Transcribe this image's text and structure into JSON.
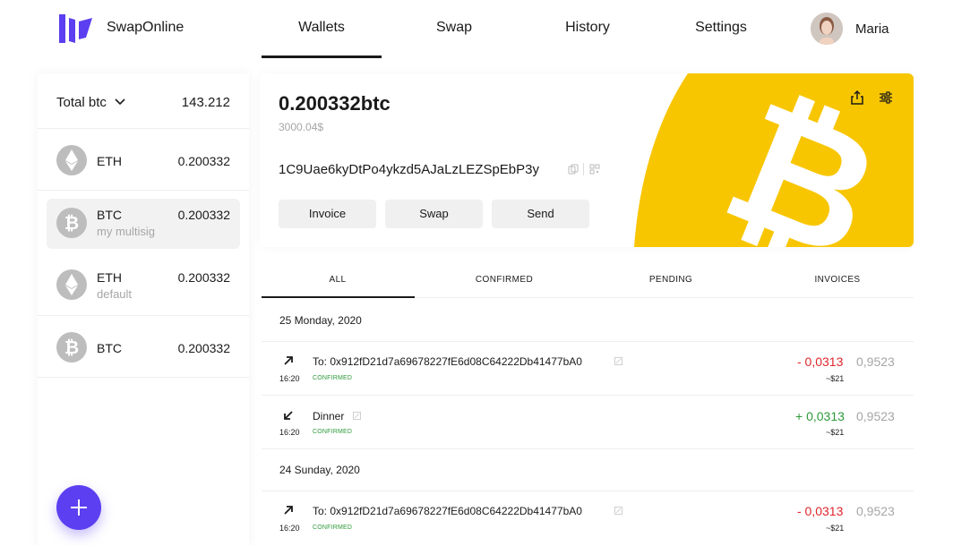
{
  "header": {
    "brand": "SwapOnline",
    "nav": [
      "Wallets",
      "Swap",
      "History",
      "Settings"
    ],
    "active_nav": "Wallets",
    "user_name": "Maria",
    "brand_color": "#5b3ff0"
  },
  "sidebar": {
    "total_label": "Total btc",
    "total_value": "143.212",
    "wallets": [
      {
        "coin": "ETH",
        "subtitle": "",
        "amount": "0.200332",
        "icon": "eth-icon"
      },
      {
        "coin": "BTC",
        "subtitle": "my multisig",
        "amount": "0.200332",
        "icon": "btc-icon",
        "active": true
      },
      {
        "coin": "ETH",
        "subtitle": "default",
        "amount": "0.200332",
        "icon": "eth-icon"
      },
      {
        "coin": "BTC",
        "subtitle": "",
        "amount": "0.200332",
        "icon": "btc-icon"
      }
    ]
  },
  "wallet_card": {
    "balance": "0.200332btc",
    "balance_usd": "3000.04$",
    "address": "1C9Uae6kyDtPo4ykzd5AJaLzLEZSpEbP3y",
    "buttons": [
      "Invoice",
      "Swap",
      "Send"
    ],
    "accent_color": "#f8c600"
  },
  "tabs": [
    "ALL",
    "CONFIRMED",
    "PENDING",
    "INVOICES"
  ],
  "transactions": {
    "groups": [
      {
        "date": "25 Monday, 2020",
        "items": [
          {
            "direction": "out",
            "title": "To: 0x912fD21d7a69678227fE6d08C64222Db41477bA0",
            "time": "16:20",
            "status": "CONFIRMED",
            "amount": "- 0,0313",
            "total": "0,9523",
            "usd": "~$21"
          },
          {
            "direction": "in",
            "title": "Dinner",
            "time": "16:20",
            "status": "CONFIRMED",
            "amount": "+ 0,0313",
            "total": "0,9523",
            "usd": "~$21"
          }
        ]
      },
      {
        "date": "24 Sunday, 2020",
        "items": [
          {
            "direction": "out",
            "title": "To: 0x912fD21d7a69678227fE6d08C64222Db41477bA0",
            "time": "16:20",
            "status": "CONFIRMED",
            "amount": "- 0,0313",
            "total": "0,9523",
            "usd": "~$21"
          }
        ]
      }
    ]
  }
}
